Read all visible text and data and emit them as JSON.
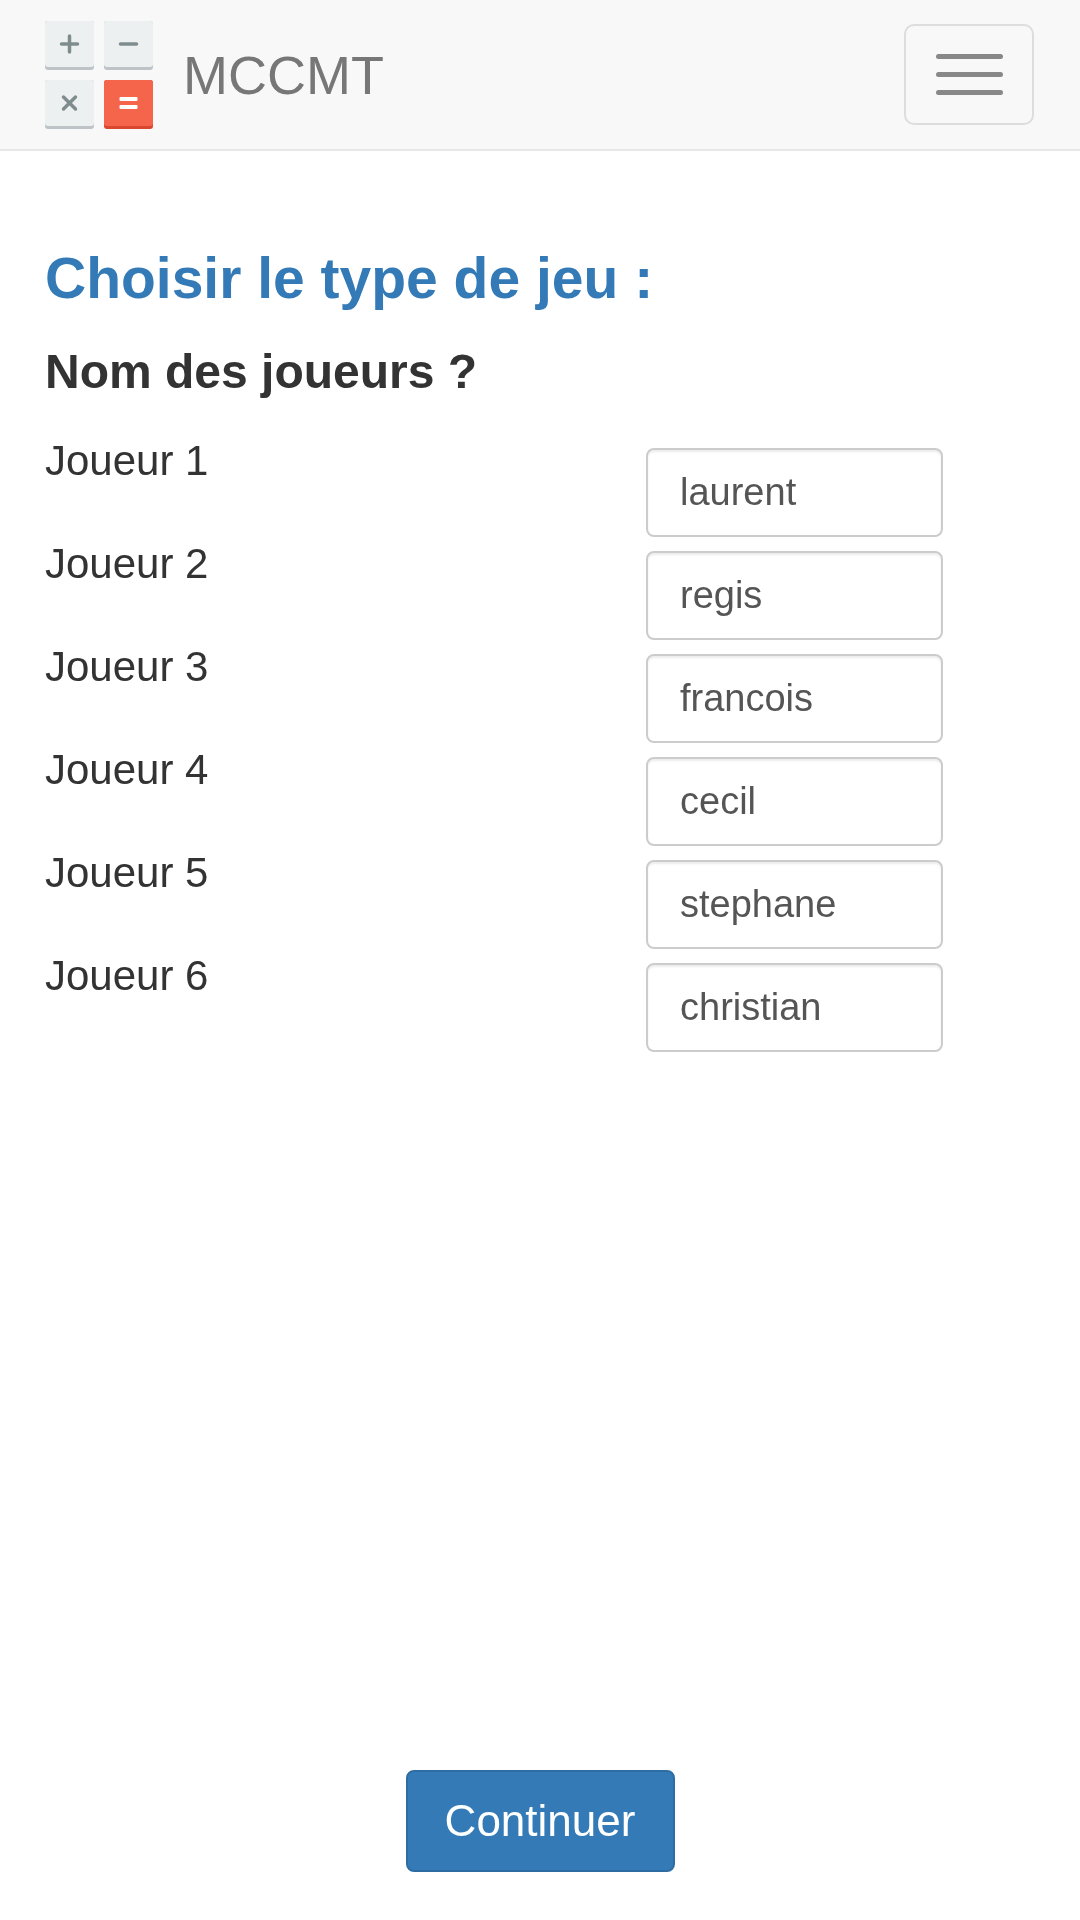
{
  "navbar": {
    "brand": "MCCMT"
  },
  "heading": "Choisir le type de jeu :",
  "subheading": "Nom des joueurs ?",
  "players": [
    {
      "label": "Joueur 1",
      "value": "laurent"
    },
    {
      "label": "Joueur 2",
      "value": "regis"
    },
    {
      "label": "Joueur 3",
      "value": "francois"
    },
    {
      "label": "Joueur 4",
      "value": "cecil"
    },
    {
      "label": "Joueur 5",
      "value": "stephane"
    },
    {
      "label": "Joueur 6",
      "value": "christian"
    }
  ],
  "continue_button": "Continuer"
}
